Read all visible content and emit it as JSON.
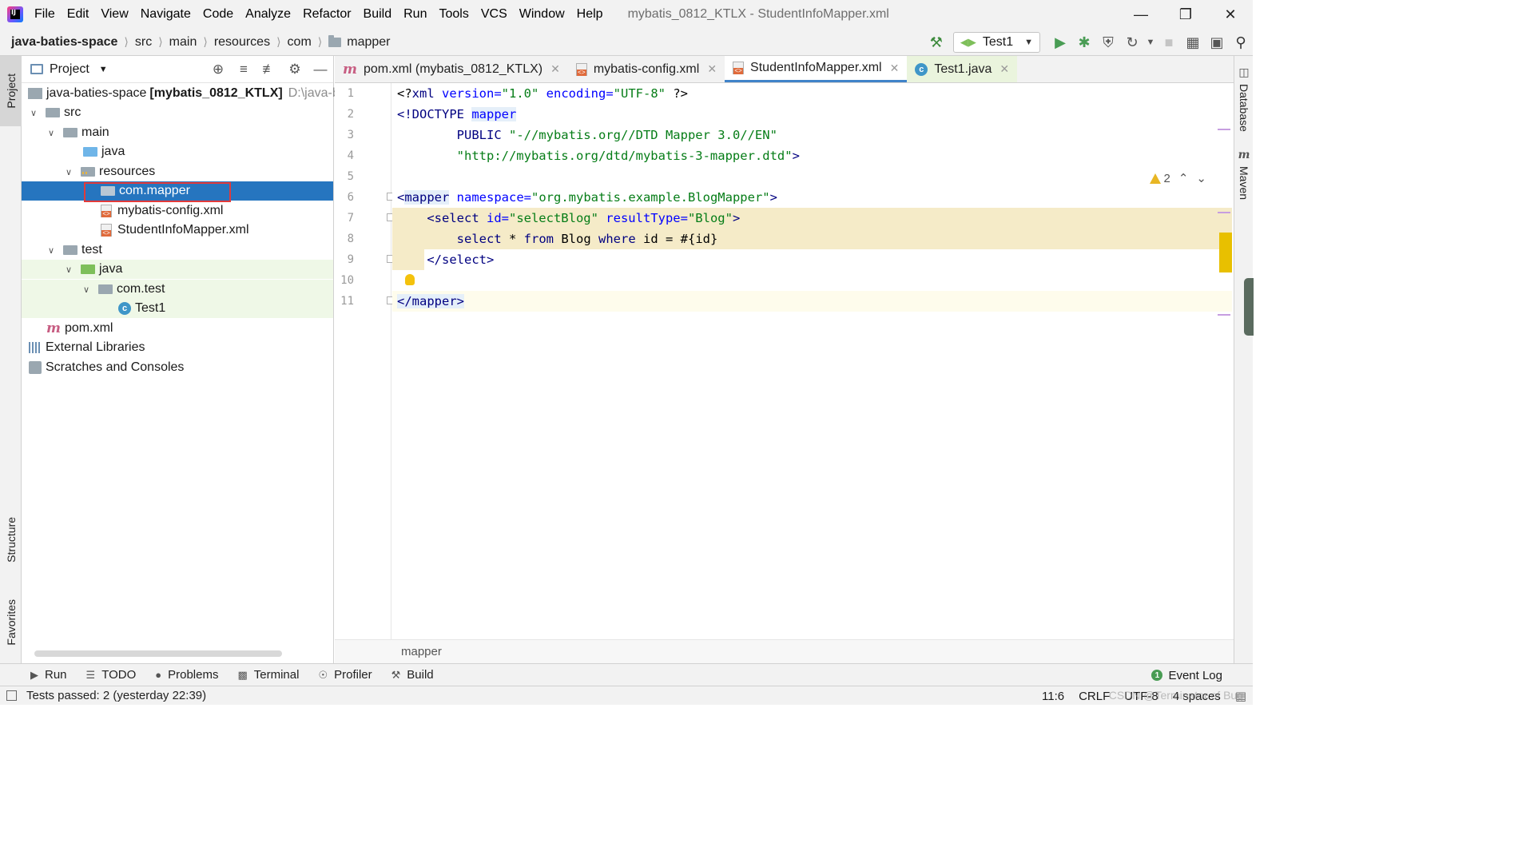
{
  "menu": {
    "items": [
      "File",
      "Edit",
      "View",
      "Navigate",
      "Code",
      "Analyze",
      "Refactor",
      "Build",
      "Run",
      "Tools",
      "VCS",
      "Window",
      "Help"
    ],
    "window_title": "mybatis_0812_KTLX - StudentInfoMapper.xml",
    "logo_text": "IJ"
  },
  "navbar": {
    "crumbs": [
      "java-baties-space",
      "src",
      "main",
      "resources",
      "com",
      "mapper"
    ],
    "run_config": "Test1"
  },
  "left_strip": {
    "project": "Project",
    "structure": "Structure",
    "favorites": "Favorites"
  },
  "project_panel": {
    "title": "Project",
    "tree": [
      {
        "label": "java-baties-space",
        "bold_suffix": "[mybatis_0812_KTLX]",
        "path": "D:\\java-ba"
      },
      {
        "label": "src"
      },
      {
        "label": "main"
      },
      {
        "label": "java"
      },
      {
        "label": "resources"
      },
      {
        "label": "com.mapper"
      },
      {
        "label": "mybatis-config.xml"
      },
      {
        "label": "StudentInfoMapper.xml"
      },
      {
        "label": "test"
      },
      {
        "label": "java"
      },
      {
        "label": "com.test"
      },
      {
        "label": "Test1"
      },
      {
        "label": "pom.xml"
      },
      {
        "label": "External Libraries"
      },
      {
        "label": "Scratches and Consoles"
      }
    ]
  },
  "editor": {
    "tabs": [
      {
        "label": "pom.xml (mybatis_0812_KTLX)"
      },
      {
        "label": "mybatis-config.xml"
      },
      {
        "label": "StudentInfoMapper.xml"
      },
      {
        "label": "Test1.java"
      }
    ],
    "line_numbers": [
      "1",
      "2",
      "3",
      "4",
      "5",
      "6",
      "7",
      "8",
      "9",
      "10",
      "11"
    ],
    "code": {
      "l1_a": "<?",
      "l1_b": "xml ",
      "l1_c": "version=",
      "l1_d": "\"1.0\"",
      "l1_e": " encoding=",
      "l1_f": "\"UTF-8\"",
      "l1_g": " ?>",
      "l2_a": "<!DOCTYPE ",
      "l2_b": "mapper",
      "l3_a": "        PUBLIC ",
      "l3_b": "\"-//mybatis.org//DTD Mapper 3.0//EN\"",
      "l4_a": "        ",
      "l4_b": "\"http://mybatis.org/dtd/mybatis-3-mapper.dtd\"",
      "l4_c": ">",
      "l6_a": "<",
      "l6_b": "mapper",
      "l6_c": " namespace=",
      "l6_d": "\"org.mybatis.example.BlogMapper\"",
      "l6_e": ">",
      "l7_a": "    <select ",
      "l7_b": "id=",
      "l7_c": "\"selectBlog\"",
      "l7_d": " resultType=",
      "l7_e": "\"Blog\"",
      "l7_f": ">",
      "l8_a": "        select ",
      "l8_b": "* ",
      "l8_c": "from ",
      "l8_d": "Blog ",
      "l8_e": "where ",
      "l8_f": "id = #{id}",
      "l9": "    </select>",
      "l11_a": "</",
      "l11_b": "mapper",
      "l11_c": ">"
    },
    "warnings_count": "2",
    "breadcrumb": "mapper"
  },
  "right_strip": {
    "database": "Database",
    "maven": "Maven",
    "maven_icon": "m"
  },
  "bottom_tools": [
    "Run",
    "TODO",
    "Problems",
    "Terminal",
    "Profiler",
    "Build"
  ],
  "event_log": "Event Log",
  "status": {
    "message": "Tests passed: 2 (yesterday 22:39)",
    "position": "11:6",
    "line_sep": "CRLF",
    "encoding": "UTF-8",
    "indent": "4 spaces"
  },
  "watermark": "CSDN @Terminator of Bug"
}
